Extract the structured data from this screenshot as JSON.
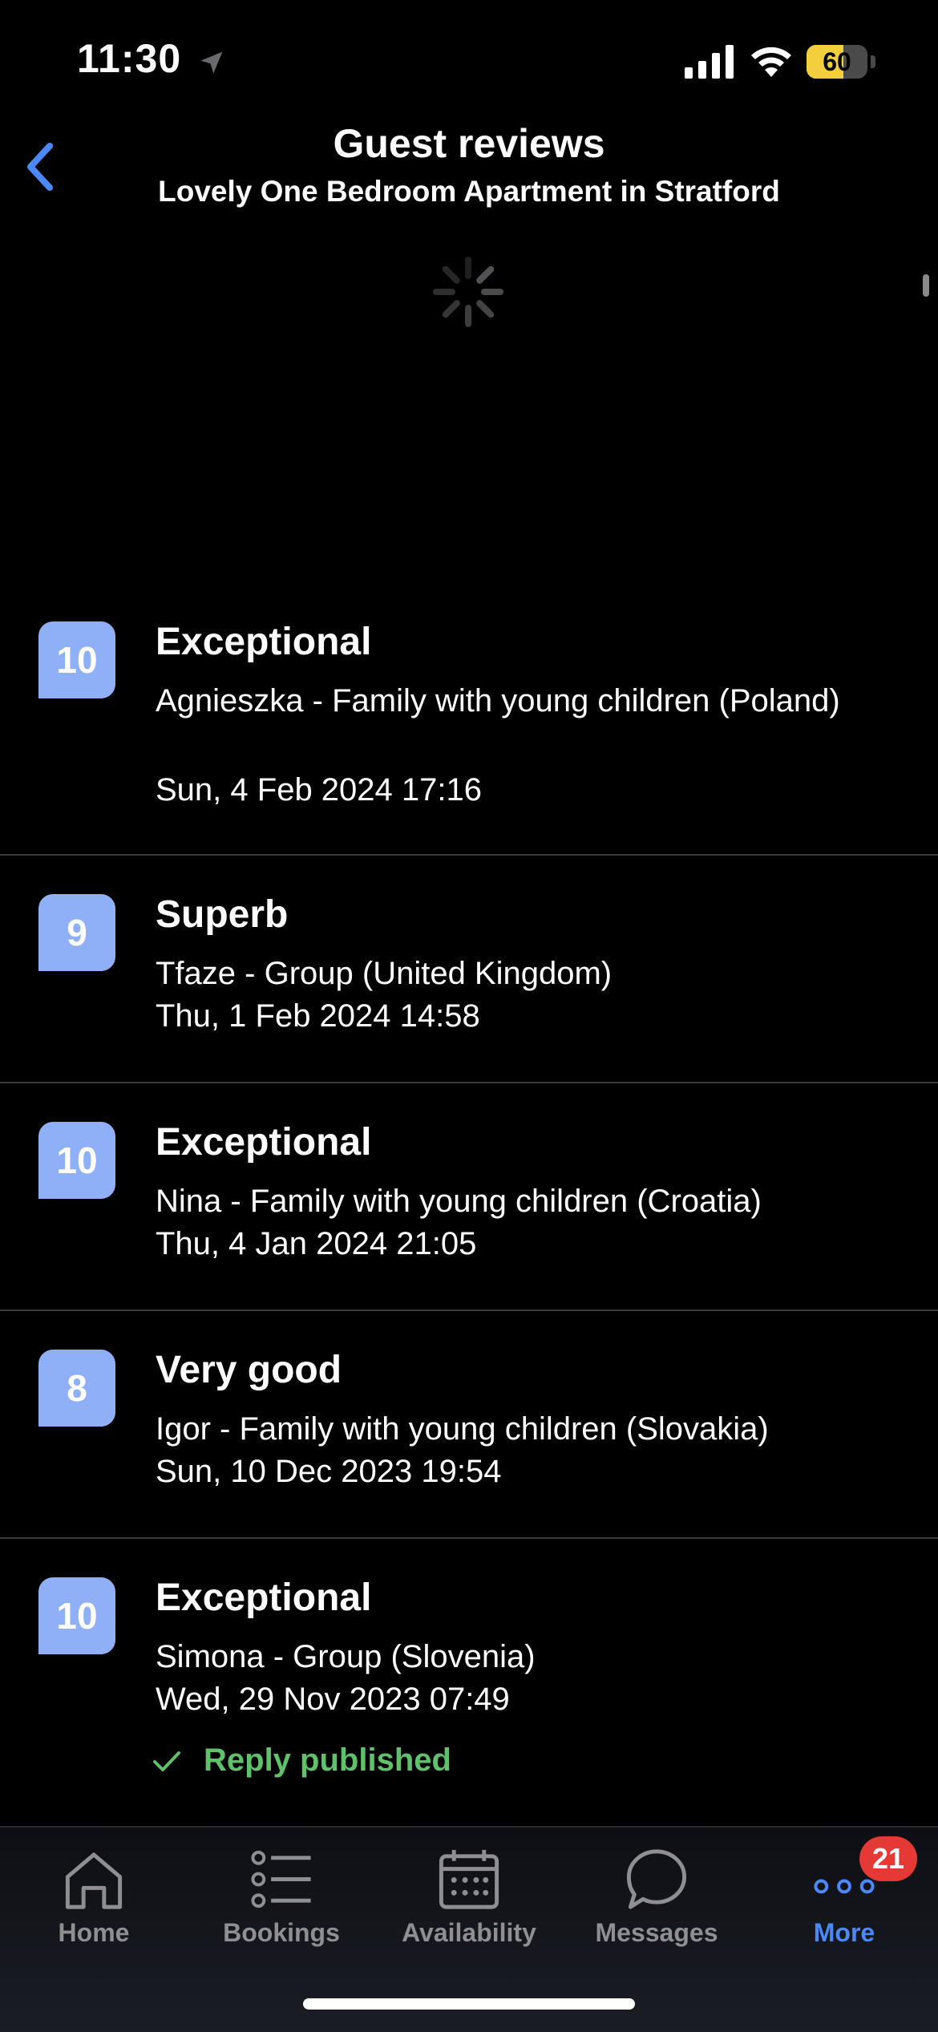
{
  "status_bar": {
    "time": "11:30",
    "battery_level": "60",
    "battery_fraction": 0.6,
    "battery_color": "#f3cf3d"
  },
  "header": {
    "title": "Guest reviews",
    "subtitle": "Lovely One Bedroom Apartment in Stratford",
    "back_icon": "chevron-left-icon"
  },
  "loading": true,
  "reviews": [
    {
      "score": "10",
      "rating_label": "Exceptional",
      "guest": "Agnieszka - Family with young children (Poland)",
      "date": "Sun, 4 Feb 2024 17:16",
      "reply": ""
    },
    {
      "score": "9",
      "rating_label": "Superb",
      "guest": "Tfaze - Group (United Kingdom)",
      "date": "Thu, 1 Feb 2024 14:58",
      "reply": ""
    },
    {
      "score": "10",
      "rating_label": "Exceptional",
      "guest": "Nina - Family with young children (Croatia)",
      "date": "Thu, 4 Jan 2024 21:05",
      "reply": ""
    },
    {
      "score": "8",
      "rating_label": "Very good",
      "guest": "Igor - Family with young children (Slovakia)",
      "date": "Sun, 10 Dec 2023 19:54",
      "reply": ""
    },
    {
      "score": "10",
      "rating_label": "Exceptional",
      "guest": "Simona - Group (Slovenia)",
      "date": "Wed, 29 Nov 2023 07:49",
      "reply": "Reply published"
    }
  ],
  "tabs": [
    {
      "label": "Home",
      "icon": "home-icon",
      "active": false
    },
    {
      "label": "Bookings",
      "icon": "list-icon",
      "active": false
    },
    {
      "label": "Availability",
      "icon": "calendar-icon",
      "active": false
    },
    {
      "label": "Messages",
      "icon": "chat-bubble-icon",
      "active": false
    },
    {
      "label": "More",
      "icon": "more-dots-icon",
      "active": true
    }
  ],
  "more_badge": "21",
  "colors": {
    "accent": "#4a8af8",
    "score_badge": "#8fb0f6",
    "reply_green": "#5ec26a",
    "notification_red": "#e53935"
  }
}
